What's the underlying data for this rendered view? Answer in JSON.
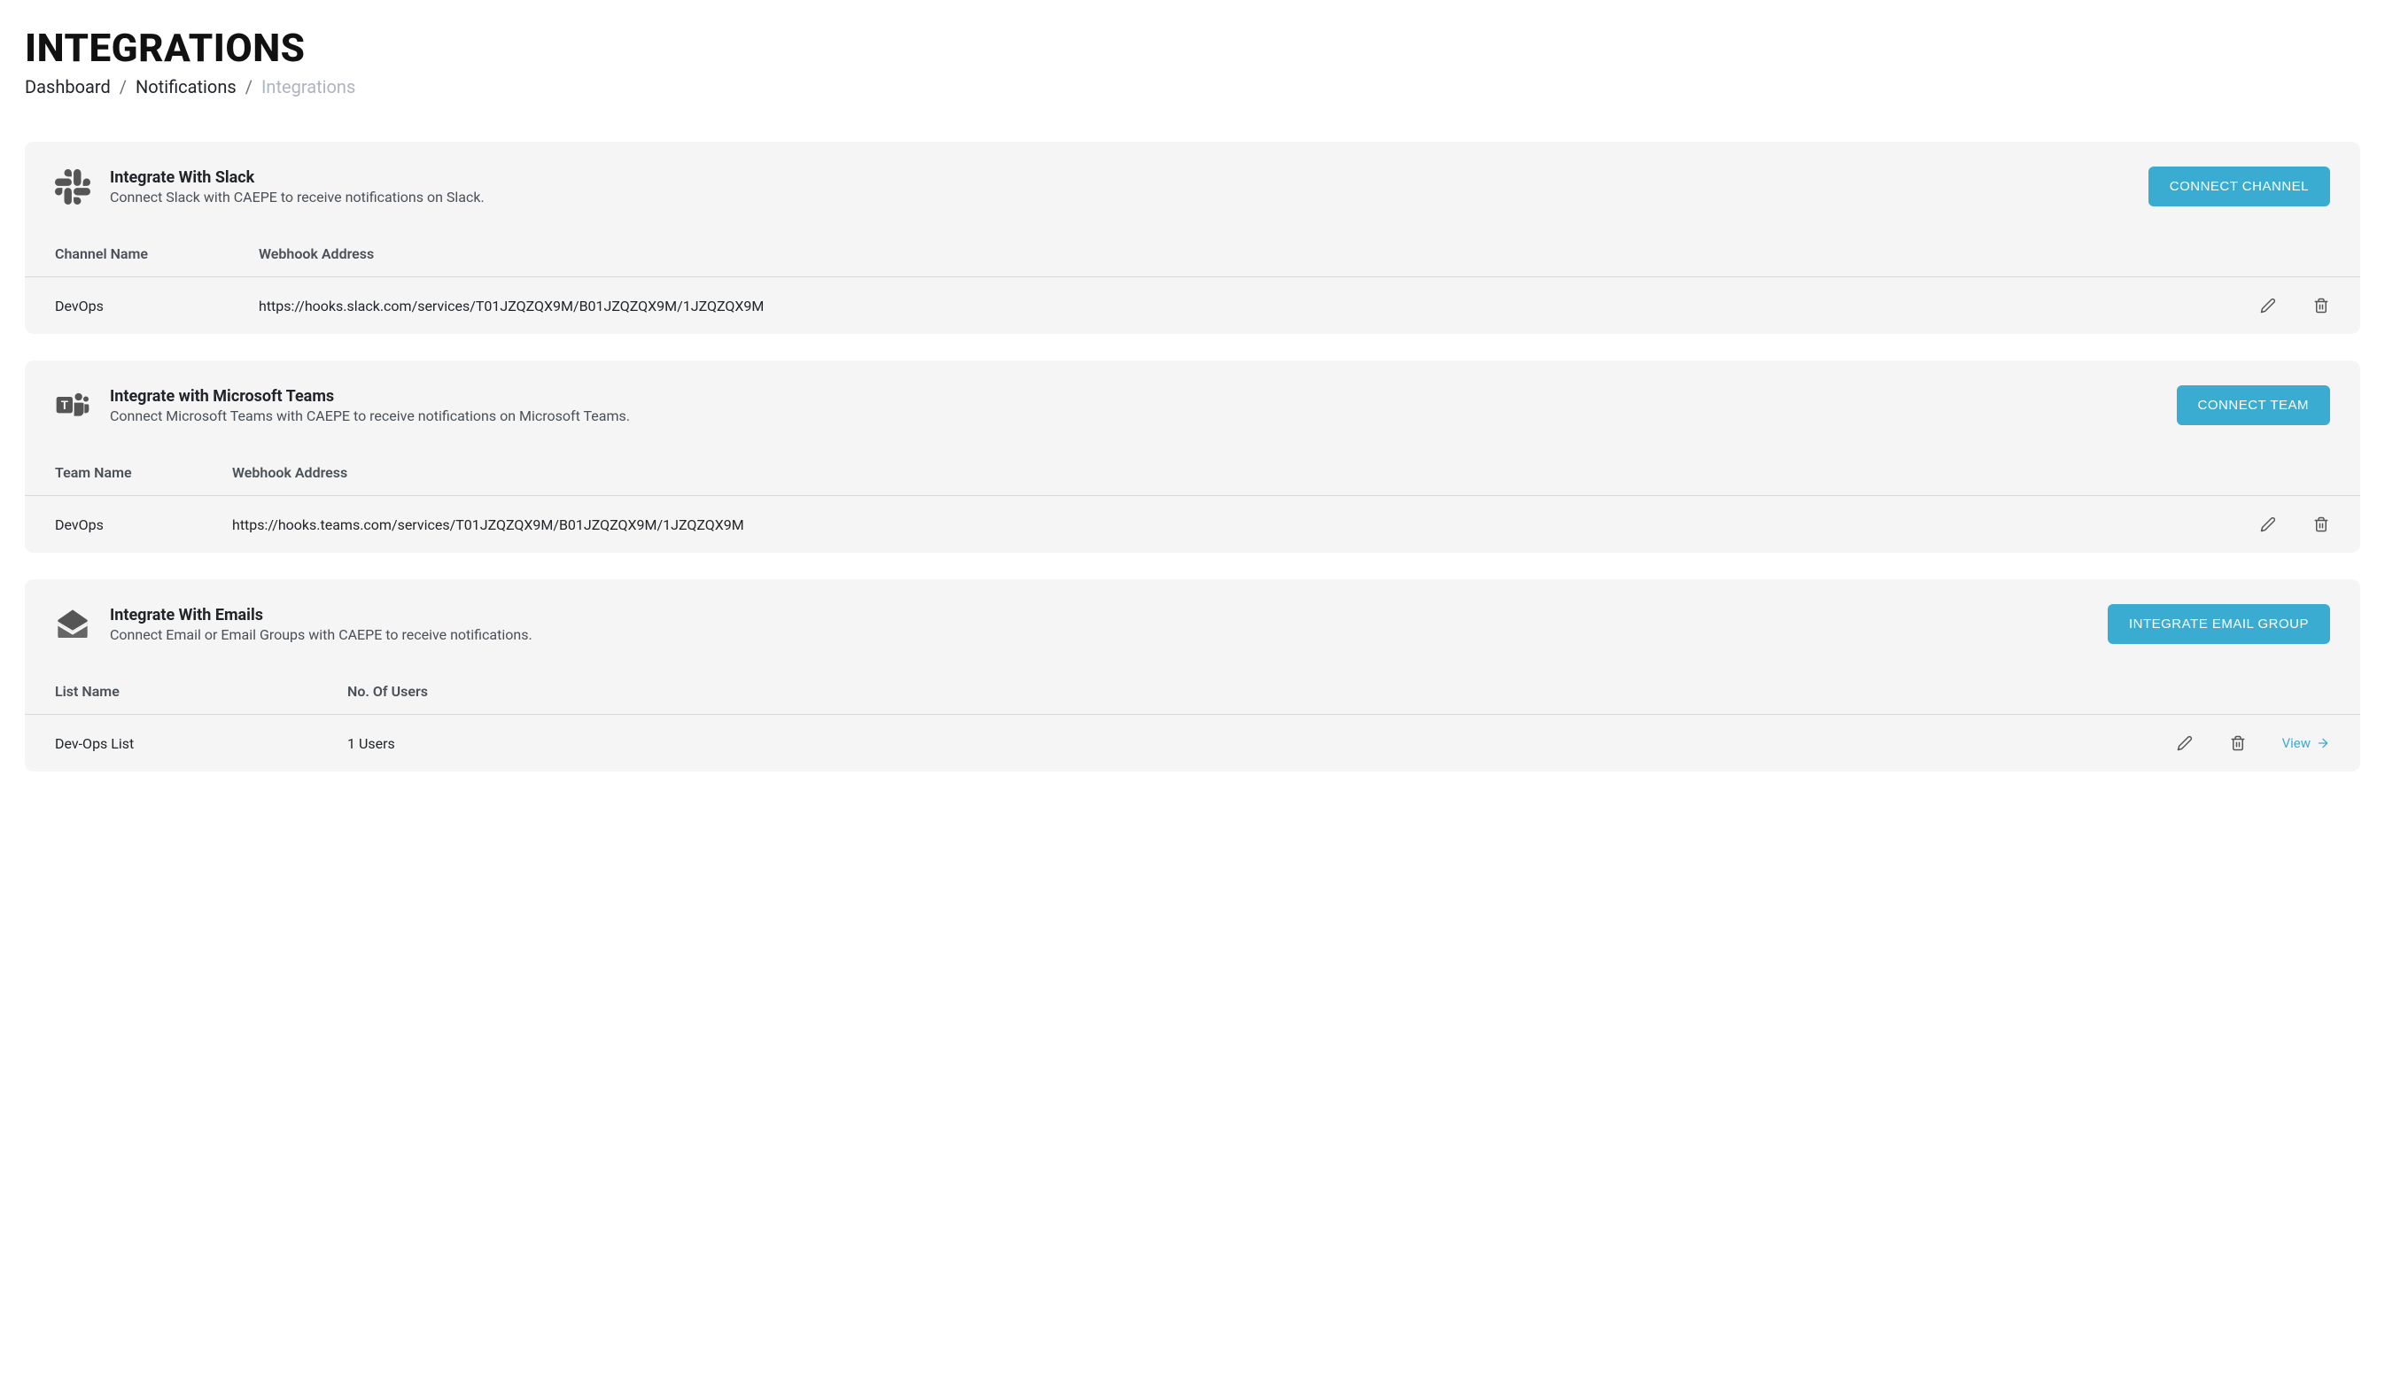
{
  "page": {
    "title": "INTEGRATIONS"
  },
  "breadcrumb": {
    "items": [
      "Dashboard",
      "Notifications",
      "Integrations"
    ],
    "sep": "/"
  },
  "slack": {
    "title": "Integrate With Slack",
    "desc": "Connect Slack with CAEPE to receive notifications on Slack.",
    "button": "CONNECT CHANNEL",
    "columns": [
      "Channel Name",
      "Webhook Address"
    ],
    "rows": [
      {
        "name": "DevOps",
        "webhook": "https://hooks.slack.com/services/T01JZQZQX9M/B01JZQZQX9M/1JZQZQX9M"
      }
    ]
  },
  "teams": {
    "title": "Integrate with Microsoft Teams",
    "desc": "Connect Microsoft Teams with CAEPE to receive notifications on Microsoft Teams.",
    "button": "CONNECT TEAM",
    "columns": [
      "Team Name",
      "Webhook Address"
    ],
    "rows": [
      {
        "name": "DevOps",
        "webhook": "https://hooks.teams.com/services/T01JZQZQX9M/B01JZQZQX9M/1JZQZQX9M"
      }
    ]
  },
  "emails": {
    "title": "Integrate With Emails",
    "desc": "Connect Email or Email Groups with CAEPE to receive notifications.",
    "button": "INTEGRATE EMAIL GROUP",
    "columns": [
      "List Name",
      "No. Of Users"
    ],
    "rows": [
      {
        "name": "Dev-Ops List",
        "users": "1 Users"
      }
    ],
    "view_label": "View"
  }
}
